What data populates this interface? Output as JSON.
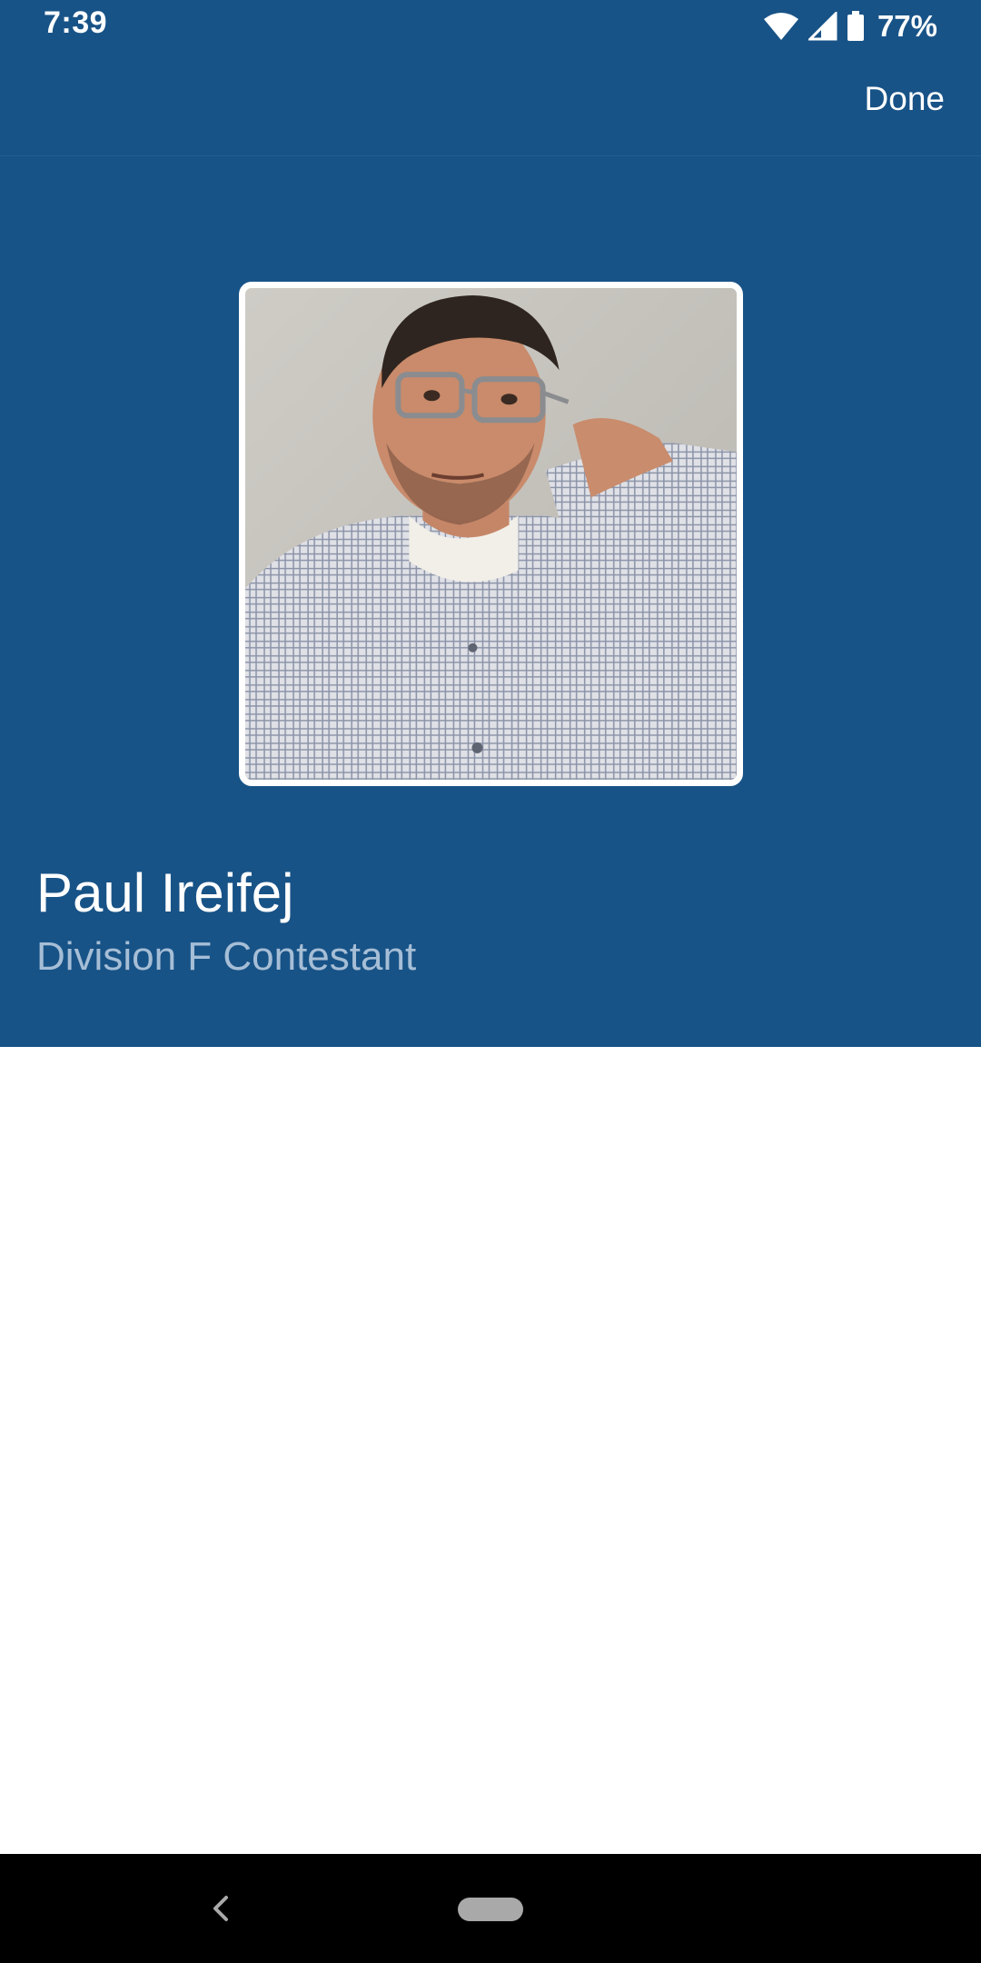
{
  "status_bar": {
    "time": "7:39",
    "battery_percent": "77%",
    "icons": [
      "wifi-icon",
      "cell-signal-icon",
      "battery-icon"
    ]
  },
  "app_bar": {
    "done_label": "Done"
  },
  "profile": {
    "name": "Paul Ireifej",
    "role": "Division F Contestant"
  },
  "nav_bar": {
    "icons": [
      "back-icon",
      "home-pill"
    ]
  },
  "colors": {
    "header_background": "#185387",
    "role_text": "#a6bed6",
    "body_background": "#ffffff"
  }
}
